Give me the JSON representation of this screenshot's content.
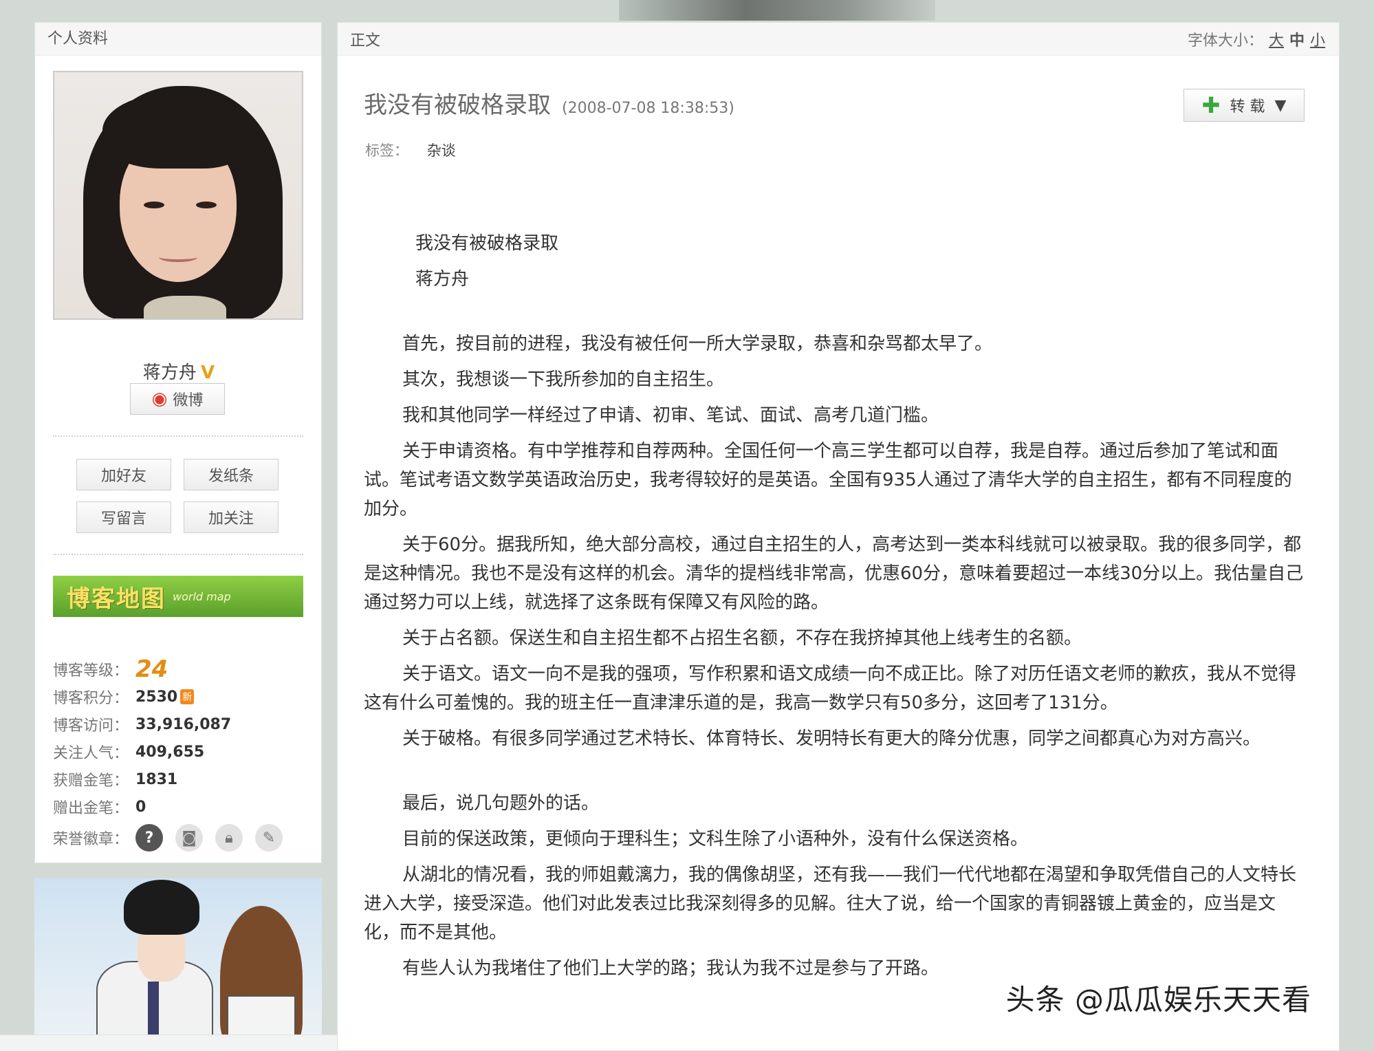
{
  "sidebar": {
    "header": "个人资料",
    "name": "蒋方舟",
    "vip_icon": "V",
    "weibo_label": "微博",
    "actions": [
      "加好友",
      "发纸条",
      "写留言",
      "加关注"
    ],
    "blog_map": {
      "main": "博客地图",
      "sub": "world map"
    },
    "stats": {
      "level_label": "博客等级：",
      "level_value": "24",
      "points_label": "博客积分：",
      "points_value": "2530",
      "points_badge": "新",
      "visits_label": "博客访问：",
      "visits_value": "33,916,087",
      "follow_label": "关注人气：",
      "follow_value": "409,655",
      "pen_recv_label": "获赠金笔：",
      "pen_recv_value": "1831",
      "pen_sent_label": "赠出金笔：",
      "pen_sent_value": "0",
      "honor_label": "荣誉徽章："
    },
    "honor_icons": [
      "question-badge-icon",
      "camera-badge-icon",
      "lock-badge-icon",
      "pen-badge-icon"
    ]
  },
  "main": {
    "header": "正文",
    "font_size_label": "字体大小：",
    "font_sizes": [
      "大",
      "中",
      "小"
    ],
    "title": "我没有被破格录取",
    "time": "(2008-07-08 18:38:53)",
    "repost_label": "转 载",
    "tags_label": "标签：",
    "tags_value": "杂谈",
    "head_lines": [
      "我没有被破格录取",
      "蒋方舟"
    ],
    "paragraphs": [
      "首先，按目前的进程，我没有被任何一所大学录取，恭喜和杂骂都太早了。",
      "其次，我想谈一下我所参加的自主招生。",
      "我和其他同学一样经过了申请、初审、笔试、面试、高考几道门槛。",
      "关于申请资格。有中学推荐和自荐两种。全国任何一个高三学生都可以自荐，我是自荐。通过后参加了笔试和面试。笔试考语文数学英语政治历史，我考得较好的是英语。全国有935人通过了清华大学的自主招生，都有不同程度的加分。",
      "关于60分。据我所知，绝大部分高校，通过自主招生的人，高考达到一类本科线就可以被录取。我的很多同学，都是这种情况。我也不是没有这样的机会。清华的提档线非常高，优惠60分，意味着要超过一本线30分以上。我估量自己通过努力可以上线，就选择了这条既有保障又有风险的路。",
      "关于占名额。保送生和自主招生都不占招生名额，不存在我挤掉其他上线考生的名额。",
      "关于语文。语文一向不是我的强项，写作积累和语文成绩一向不成正比。除了对历任语文老师的歉疚，我从不觉得这有什么可羞愧的。我的班主任一直津津乐道的是，我高一数学只有50多分，这回考了131分。",
      "关于破格。有很多同学通过艺术特长、体育特长、发明特长有更大的降分优惠，同学之间都真心为对方高兴。"
    ],
    "paragraphs2": [
      "最后，说几句题外的话。",
      "目前的保送政策，更倾向于理科生；文科生除了小语种外，没有什么保送资格。",
      "从湖北的情况看，我的师姐戴漓力，我的偶像胡坚，还有我——我们一代代地都在渴望和争取凭借自己的人文特长进入大学，接受深造。他们对此发表过比我深刻得多的见解。往大了说，给一个国家的青铜器镀上黄金的，应当是文化，而不是其他。",
      "有些人认为我堵住了他们上大学的路；我认为我不过是参与了开路。"
    ],
    "watermark": "头条 @瓜瓜娱乐天天看"
  }
}
